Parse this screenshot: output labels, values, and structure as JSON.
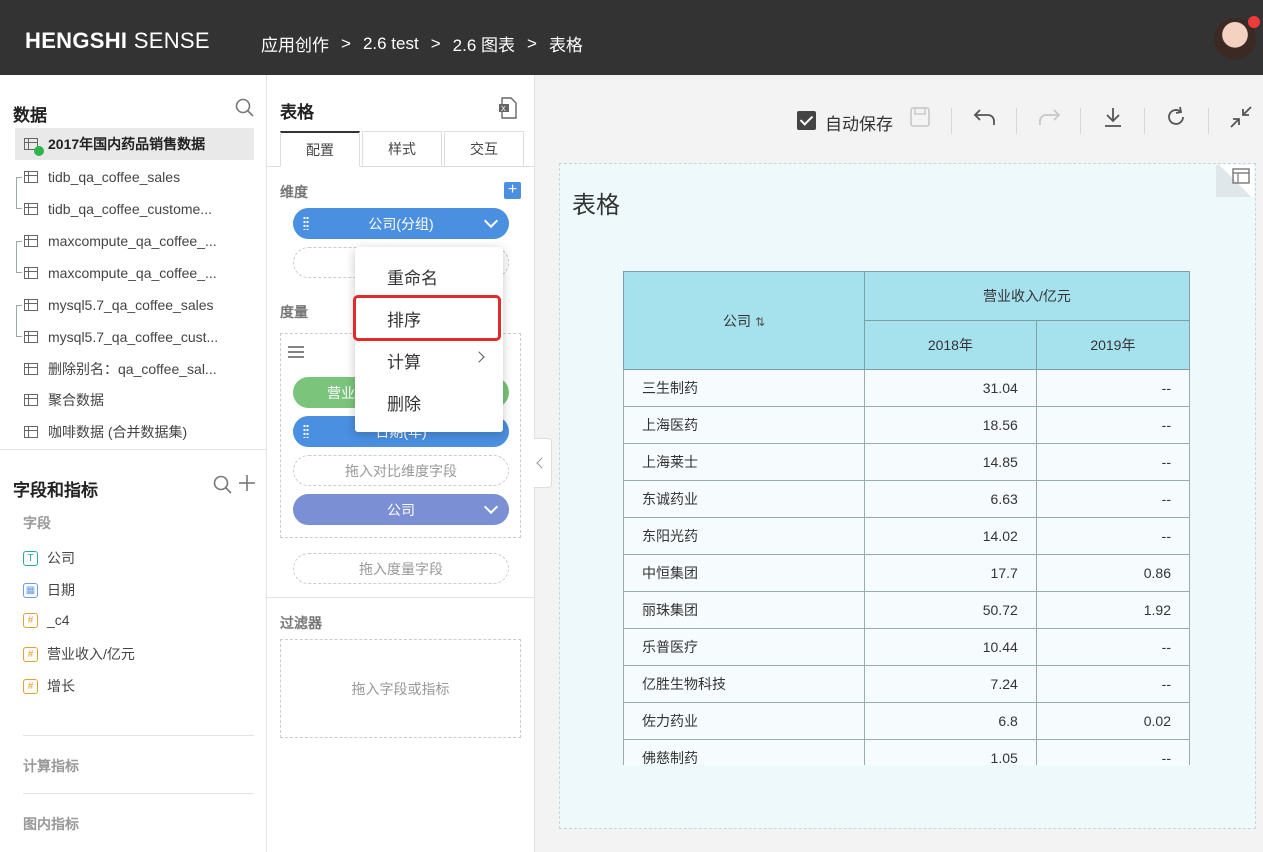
{
  "header": {
    "brand_bold": "HENGSHI",
    "brand_light": "SENSE",
    "breadcrumbs": [
      "应用创作",
      "2.6 test",
      "2.6 图表",
      "表格"
    ],
    "separator": ">"
  },
  "data_panel": {
    "title": "数据",
    "datasets": [
      "2017年国内药品销售数据",
      "tidb_qa_coffee_sales",
      "tidb_qa_coffee_custome...",
      "maxcompute_qa_coffee_...",
      "maxcompute_qa_coffee_...",
      "mysql5.7_qa_coffee_sales",
      "mysql5.7_qa_coffee_cust...",
      "删除别名：qa_coffee_sal...",
      "聚合数据",
      "咖啡数据 (合并数据集)"
    ]
  },
  "fields_panel": {
    "title": "字段和指标",
    "fields_label": "字段",
    "fields": [
      {
        "type": "T",
        "name": "公司"
      },
      {
        "type": "▦",
        "name": "日期"
      },
      {
        "type": "#",
        "name": "_c4"
      },
      {
        "type": "#",
        "name": "营业收入/亿元"
      },
      {
        "type": "#",
        "name": "增长"
      }
    ],
    "calc_metrics": "计算指标",
    "chart_metrics": "图内指标"
  },
  "config_panel": {
    "title": "表格",
    "tabs": [
      "配置",
      "样式",
      "交互"
    ],
    "dimension_label": "维度",
    "dimension_pill": "公司(分组)",
    "measure_label": "度量",
    "measure_pill_green": "营业",
    "measure_pill_blue": "日期(年)",
    "drop_compare": "拖入对比维度字段",
    "compare_pill": "公司",
    "drop_measure": "拖入度量字段",
    "filter_label": "过滤器",
    "filter_drop": "拖入字段或指标"
  },
  "context_menu": {
    "items": [
      "重命名",
      "排序",
      "计算",
      "删除"
    ]
  },
  "toolbar": {
    "autosave_label": "自动保存",
    "autosave_checked": true
  },
  "chart": {
    "title": "表格"
  },
  "chart_data": {
    "type": "table",
    "row_header": "公司",
    "group_header": "营业收入/亿元",
    "columns": [
      "2018年",
      "2019年"
    ],
    "rows": [
      {
        "company": "三生制药",
        "v2018": "31.04",
        "v2019": "--"
      },
      {
        "company": "上海医药",
        "v2018": "18.56",
        "v2019": "--"
      },
      {
        "company": "上海莱士",
        "v2018": "14.85",
        "v2019": "--"
      },
      {
        "company": "东诚药业",
        "v2018": "6.63",
        "v2019": "--"
      },
      {
        "company": "东阳光药",
        "v2018": "14.02",
        "v2019": "--"
      },
      {
        "company": "中恒集团",
        "v2018": "17.7",
        "v2019": "0.86"
      },
      {
        "company": "丽珠集团",
        "v2018": "50.72",
        "v2019": "1.92"
      },
      {
        "company": "乐普医疗",
        "v2018": "10.44",
        "v2019": "--"
      },
      {
        "company": "亿胜生物科技",
        "v2018": "7.24",
        "v2019": "--"
      },
      {
        "company": "佐力药业",
        "v2018": "6.8",
        "v2019": "0.02"
      },
      {
        "company": "佛慈制药",
        "v2018": "1.05",
        "v2019": "--"
      }
    ]
  },
  "colors": {
    "topbar": "#333333",
    "pill_blue": "#4a8fe0",
    "pill_green": "#7bc47b",
    "pill_purple": "#7b8fd4",
    "table_header": "#a6e2ee",
    "highlight": "#e32a2a"
  }
}
